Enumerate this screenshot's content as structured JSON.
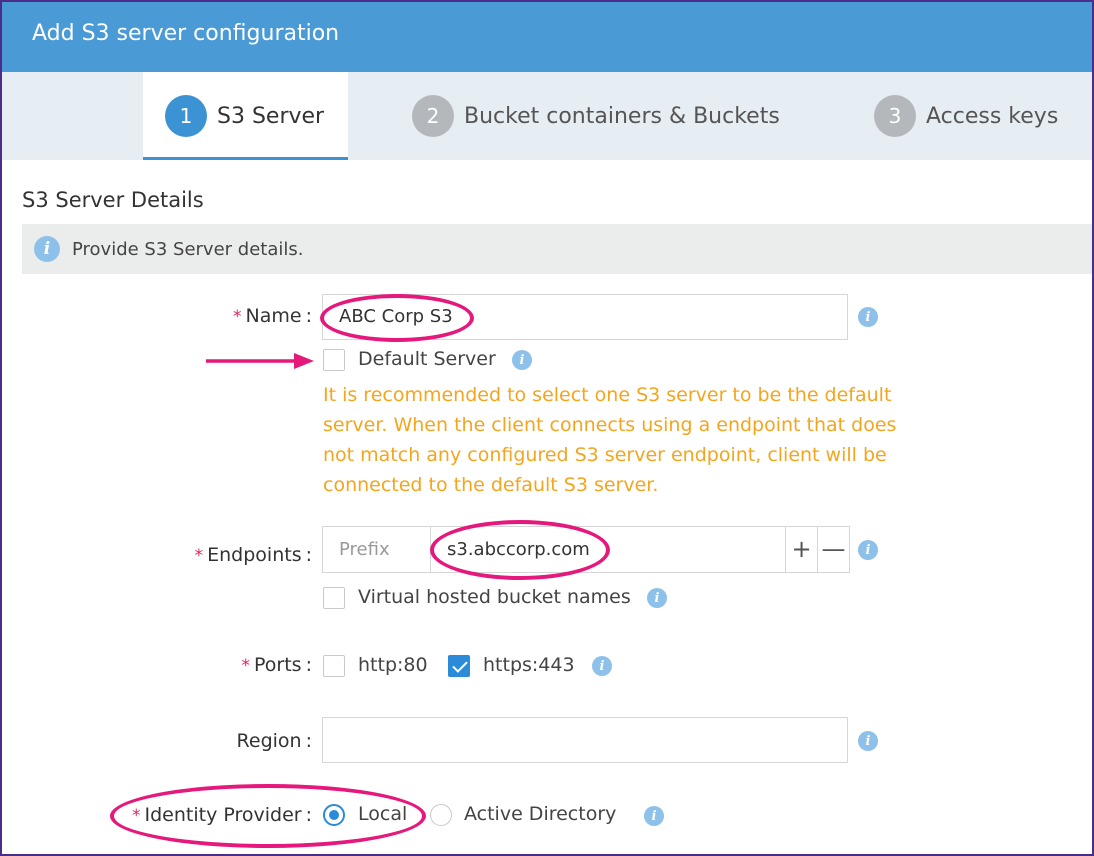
{
  "window": {
    "title": "Add S3 server configuration"
  },
  "steps": [
    {
      "number": "1",
      "label": "S3 Server",
      "active": true
    },
    {
      "number": "2",
      "label": "Bucket containers & Buckets",
      "active": false
    },
    {
      "number": "3",
      "label": "Access keys",
      "active": false
    }
  ],
  "section": {
    "title": "S3 Server Details",
    "info": "Provide S3 Server details."
  },
  "form": {
    "name": {
      "label": "Name",
      "required": true,
      "value": "ABC Corp S3"
    },
    "default_server": {
      "label": "Default Server",
      "checked": false,
      "warning": "It is recommended to select one S3 server to be the default server. When the client connects using a endpoint that does not match any configured S3 server endpoint, client will be connected to the default S3 server."
    },
    "endpoints": {
      "label": "Endpoints",
      "required": true,
      "prefix_placeholder": "Prefix",
      "value": "s3.abccorp.com",
      "add_symbol": "+",
      "remove_symbol": "—"
    },
    "virtual_hosted": {
      "label": "Virtual hosted bucket names",
      "checked": false
    },
    "ports": {
      "label": "Ports",
      "required": true,
      "options": [
        {
          "label": "http:80",
          "checked": false
        },
        {
          "label": "https:443",
          "checked": true
        }
      ]
    },
    "region": {
      "label": "Region",
      "value": ""
    },
    "identity_provider": {
      "label": "Identity Provider",
      "required": true,
      "options": [
        {
          "label": "Local",
          "selected": true
        },
        {
          "label": "Active Directory",
          "selected": false
        }
      ]
    }
  },
  "symbols": {
    "required": "*",
    "colon": ":",
    "info": "i"
  },
  "colors": {
    "header": "#4a9ad6",
    "accent": "#3c93d4",
    "warning": "#f5a51d",
    "annotation": "#e5187c"
  },
  "icons": [
    "info-icon",
    "arrow-right-icon"
  ]
}
